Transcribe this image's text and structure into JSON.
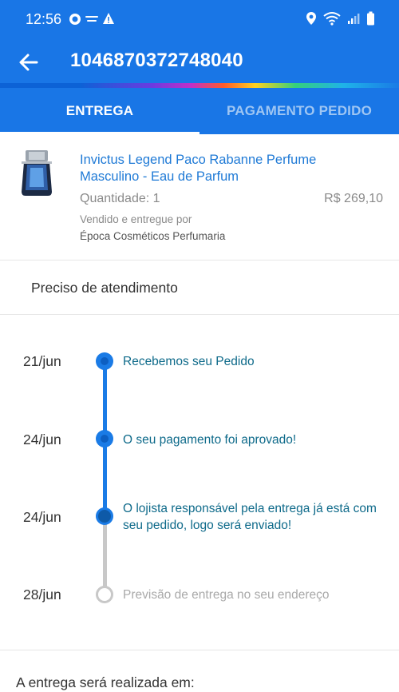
{
  "status_bar": {
    "time": "12:56",
    "icons": [
      "chat-bubble-icon",
      "claro-icon",
      "alert-triangle-icon",
      "location-icon",
      "wifi-icon",
      "signal-icon",
      "battery-icon"
    ]
  },
  "app_bar": {
    "back_icon": "arrow-left-icon",
    "title": "1046870372748040"
  },
  "tabs": [
    {
      "label": "ENTREGA",
      "active": true
    },
    {
      "label": "PAGAMENTO PEDIDO",
      "active": false
    }
  ],
  "product": {
    "name": "Invictus Legend Paco Rabanne Perfume Masculino - Eau de Parfum",
    "quantity": "Quantidade: 1",
    "price": "R$ 269,10",
    "sold_by_label": "Vendido e entregue por",
    "seller": "Época Cosméticos Perfumaria"
  },
  "help": {
    "label": "Preciso de atendimento"
  },
  "timeline": {
    "events": [
      {
        "date": "21/jun",
        "text": "Recebemos seu Pedido",
        "state": "done"
      },
      {
        "date": "24/jun",
        "text": "O seu pagamento foi aprovado!",
        "state": "done"
      },
      {
        "date": "24/jun",
        "text": "O lojista responsável pela entrega já está com seu pedido, logo será enviado!",
        "state": "current"
      },
      {
        "date": "28/jun",
        "text": "Previsão de entrega no seu endereço",
        "state": "pending"
      }
    ]
  },
  "footer": {
    "label": "A entrega será realizada em:"
  },
  "colors": {
    "primary": "#1976e6",
    "link_blue": "#1f7ad6",
    "timeline_text": "#0e6a8a",
    "muted": "#8a8a8a"
  }
}
